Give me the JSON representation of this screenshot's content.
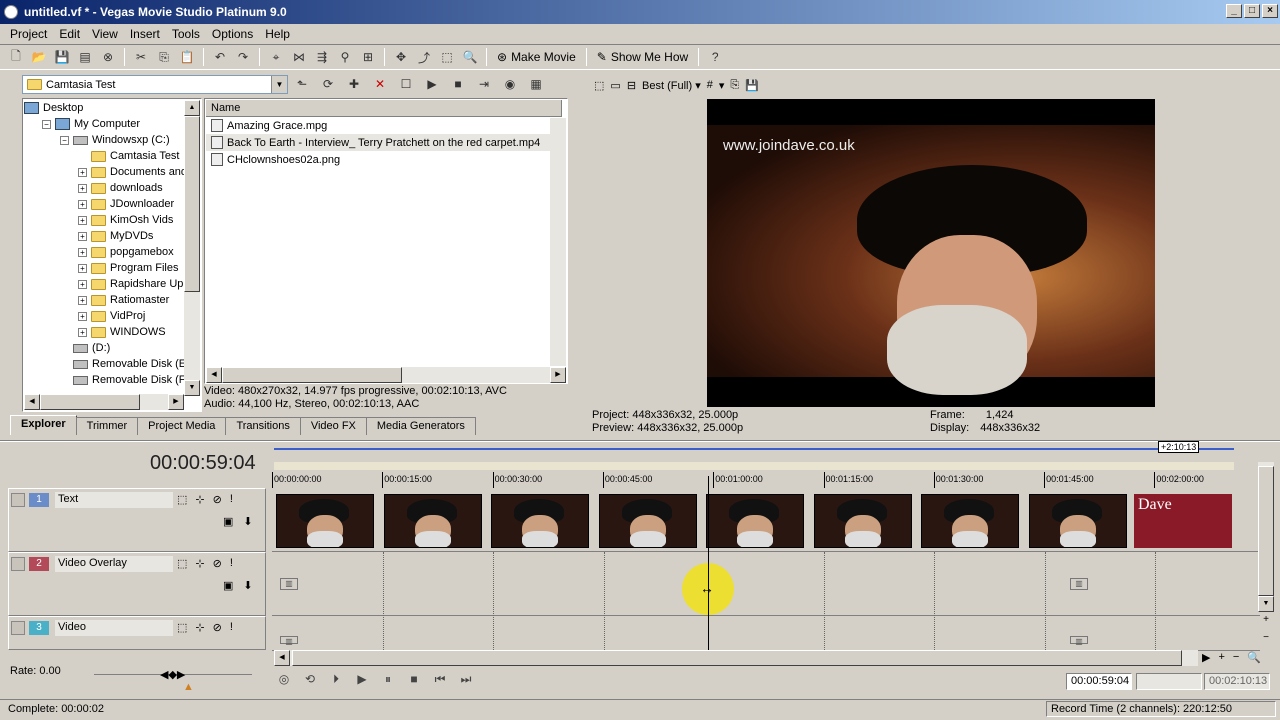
{
  "window": {
    "title": "untitled.vf * - Vegas Movie Studio Platinum 9.0"
  },
  "menu": [
    "Project",
    "Edit",
    "View",
    "Insert",
    "Tools",
    "Options",
    "Help"
  ],
  "toolbar": {
    "make_movie": "Make Movie",
    "show_me_how": "Show Me How"
  },
  "explorer": {
    "path": "Camtasia Test",
    "tree": [
      {
        "label": "Desktop",
        "level": 0,
        "icon": "desktop"
      },
      {
        "label": "My Computer",
        "level": 1,
        "icon": "computer"
      },
      {
        "label": "Windowsxp (C:)",
        "level": 2,
        "icon": "drive"
      },
      {
        "label": "Camtasia Test",
        "level": 3,
        "icon": "folder"
      },
      {
        "label": "Documents and",
        "level": 3,
        "icon": "folder"
      },
      {
        "label": "downloads",
        "level": 3,
        "icon": "folder"
      },
      {
        "label": "JDownloader",
        "level": 3,
        "icon": "folder"
      },
      {
        "label": "KimOsh Vids",
        "level": 3,
        "icon": "folder"
      },
      {
        "label": "MyDVDs",
        "level": 3,
        "icon": "folder"
      },
      {
        "label": "popgamebox",
        "level": 3,
        "icon": "folder"
      },
      {
        "label": "Program Files",
        "level": 3,
        "icon": "folder"
      },
      {
        "label": "Rapidshare Uplo",
        "level": 3,
        "icon": "folder"
      },
      {
        "label": "Ratiomaster",
        "level": 3,
        "icon": "folder"
      },
      {
        "label": "VidProj",
        "level": 3,
        "icon": "folder"
      },
      {
        "label": "WINDOWS",
        "level": 3,
        "icon": "folder"
      },
      {
        "label": "(D:)",
        "level": 2,
        "icon": "drive"
      },
      {
        "label": "Removable Disk (E:)",
        "level": 2,
        "icon": "drive"
      },
      {
        "label": "Removable Disk (F:)",
        "level": 2,
        "icon": "drive"
      }
    ],
    "column_header": "Name",
    "files": [
      "Amazing Grace.mpg",
      "Back To Earth - Interview_ Terry Pratchett on the red carpet.mp4",
      "CHclownshoes02a.png"
    ],
    "selected_file_index": 1,
    "media_info_video": "Video: 480x270x32, 14.977 fps progressive, 00:02:10:13, AVC",
    "media_info_audio": "Audio: 44,100 Hz, Stereo, 00:02:10:13, AAC"
  },
  "tabs": [
    "Explorer",
    "Trimmer",
    "Project Media",
    "Transitions",
    "Video FX",
    "Media Generators"
  ],
  "preview": {
    "quality": "Best (Full)",
    "watermark": "www.joindave.co.uk",
    "project_label": "Project:",
    "project": "448x336x32, 25.000p",
    "preview_label": "Preview:",
    "preview": "448x336x32, 25.000p",
    "frame_label": "Frame:",
    "frame": "1,424",
    "display_label": "Display:",
    "display": "448x336x32"
  },
  "timeline": {
    "timecode": "00:00:59:04",
    "end_marker": "+2:10:13",
    "ruler": [
      "00:00:00:00",
      "00:00:15:00",
      "00:00:30:00",
      "00:00:45:00",
      "00:01:00:00",
      "00:01:15:00",
      "00:01:30:00",
      "00:01:45:00",
      "00:02:00:00"
    ],
    "tracks": [
      {
        "num": "1",
        "name": "Text",
        "color": "#6a8cc8"
      },
      {
        "num": "2",
        "name": "Video Overlay",
        "color": "#b24a5a"
      },
      {
        "num": "3",
        "name": "Video",
        "color": "#4ab0c8"
      }
    ],
    "dave_label": "Dave"
  },
  "bottom": {
    "rate": "Rate: 0.00",
    "cursor_time": "00:00:59:04",
    "end_time": "00:02:10:13",
    "status": "Complete: 00:00:02",
    "record_time": "Record Time (2 channels): 220:12:50"
  }
}
